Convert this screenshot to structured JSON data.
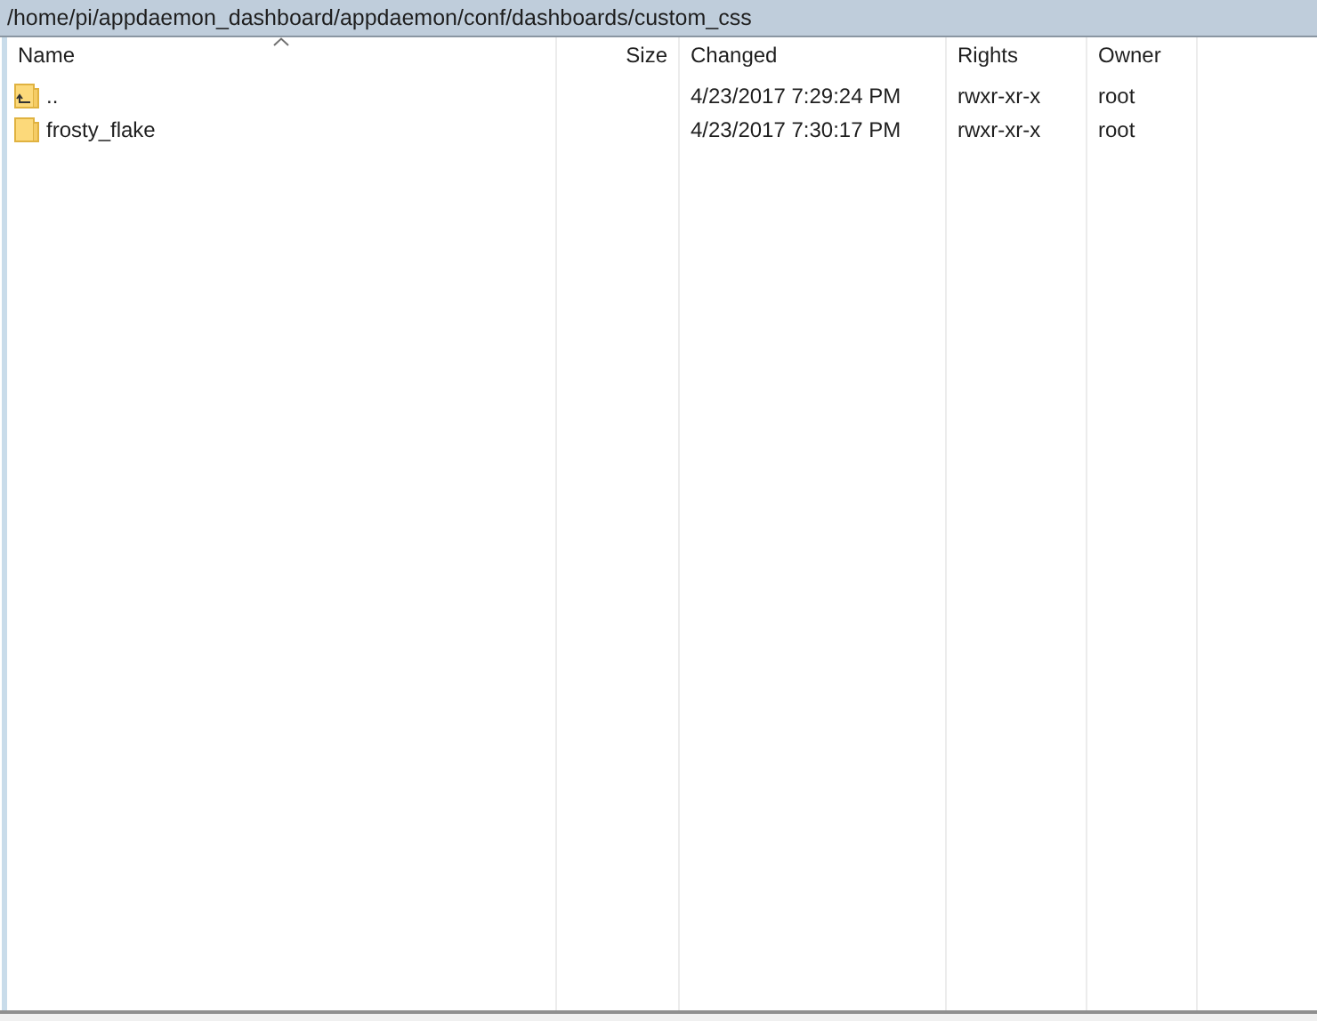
{
  "path_bar": {
    "path": "/home/pi/appdaemon_dashboard/appdaemon/conf/dashboards/custom_css"
  },
  "columns": [
    {
      "label": "Name",
      "sorted": true
    },
    {
      "label": "Size",
      "sorted": false
    },
    {
      "label": "Changed",
      "sorted": false
    },
    {
      "label": "Rights",
      "sorted": false
    },
    {
      "label": "Owner",
      "sorted": false
    }
  ],
  "rows": [
    {
      "kind": "parent",
      "cells": [
        "..",
        "",
        "4/23/2017 7:29:24 PM",
        "rwxr-xr-x",
        "root"
      ]
    },
    {
      "kind": "folder",
      "cells": [
        "frosty_flake",
        "",
        "4/23/2017 7:30:17 PM",
        "rwxr-xr-x",
        "root"
      ]
    }
  ]
}
